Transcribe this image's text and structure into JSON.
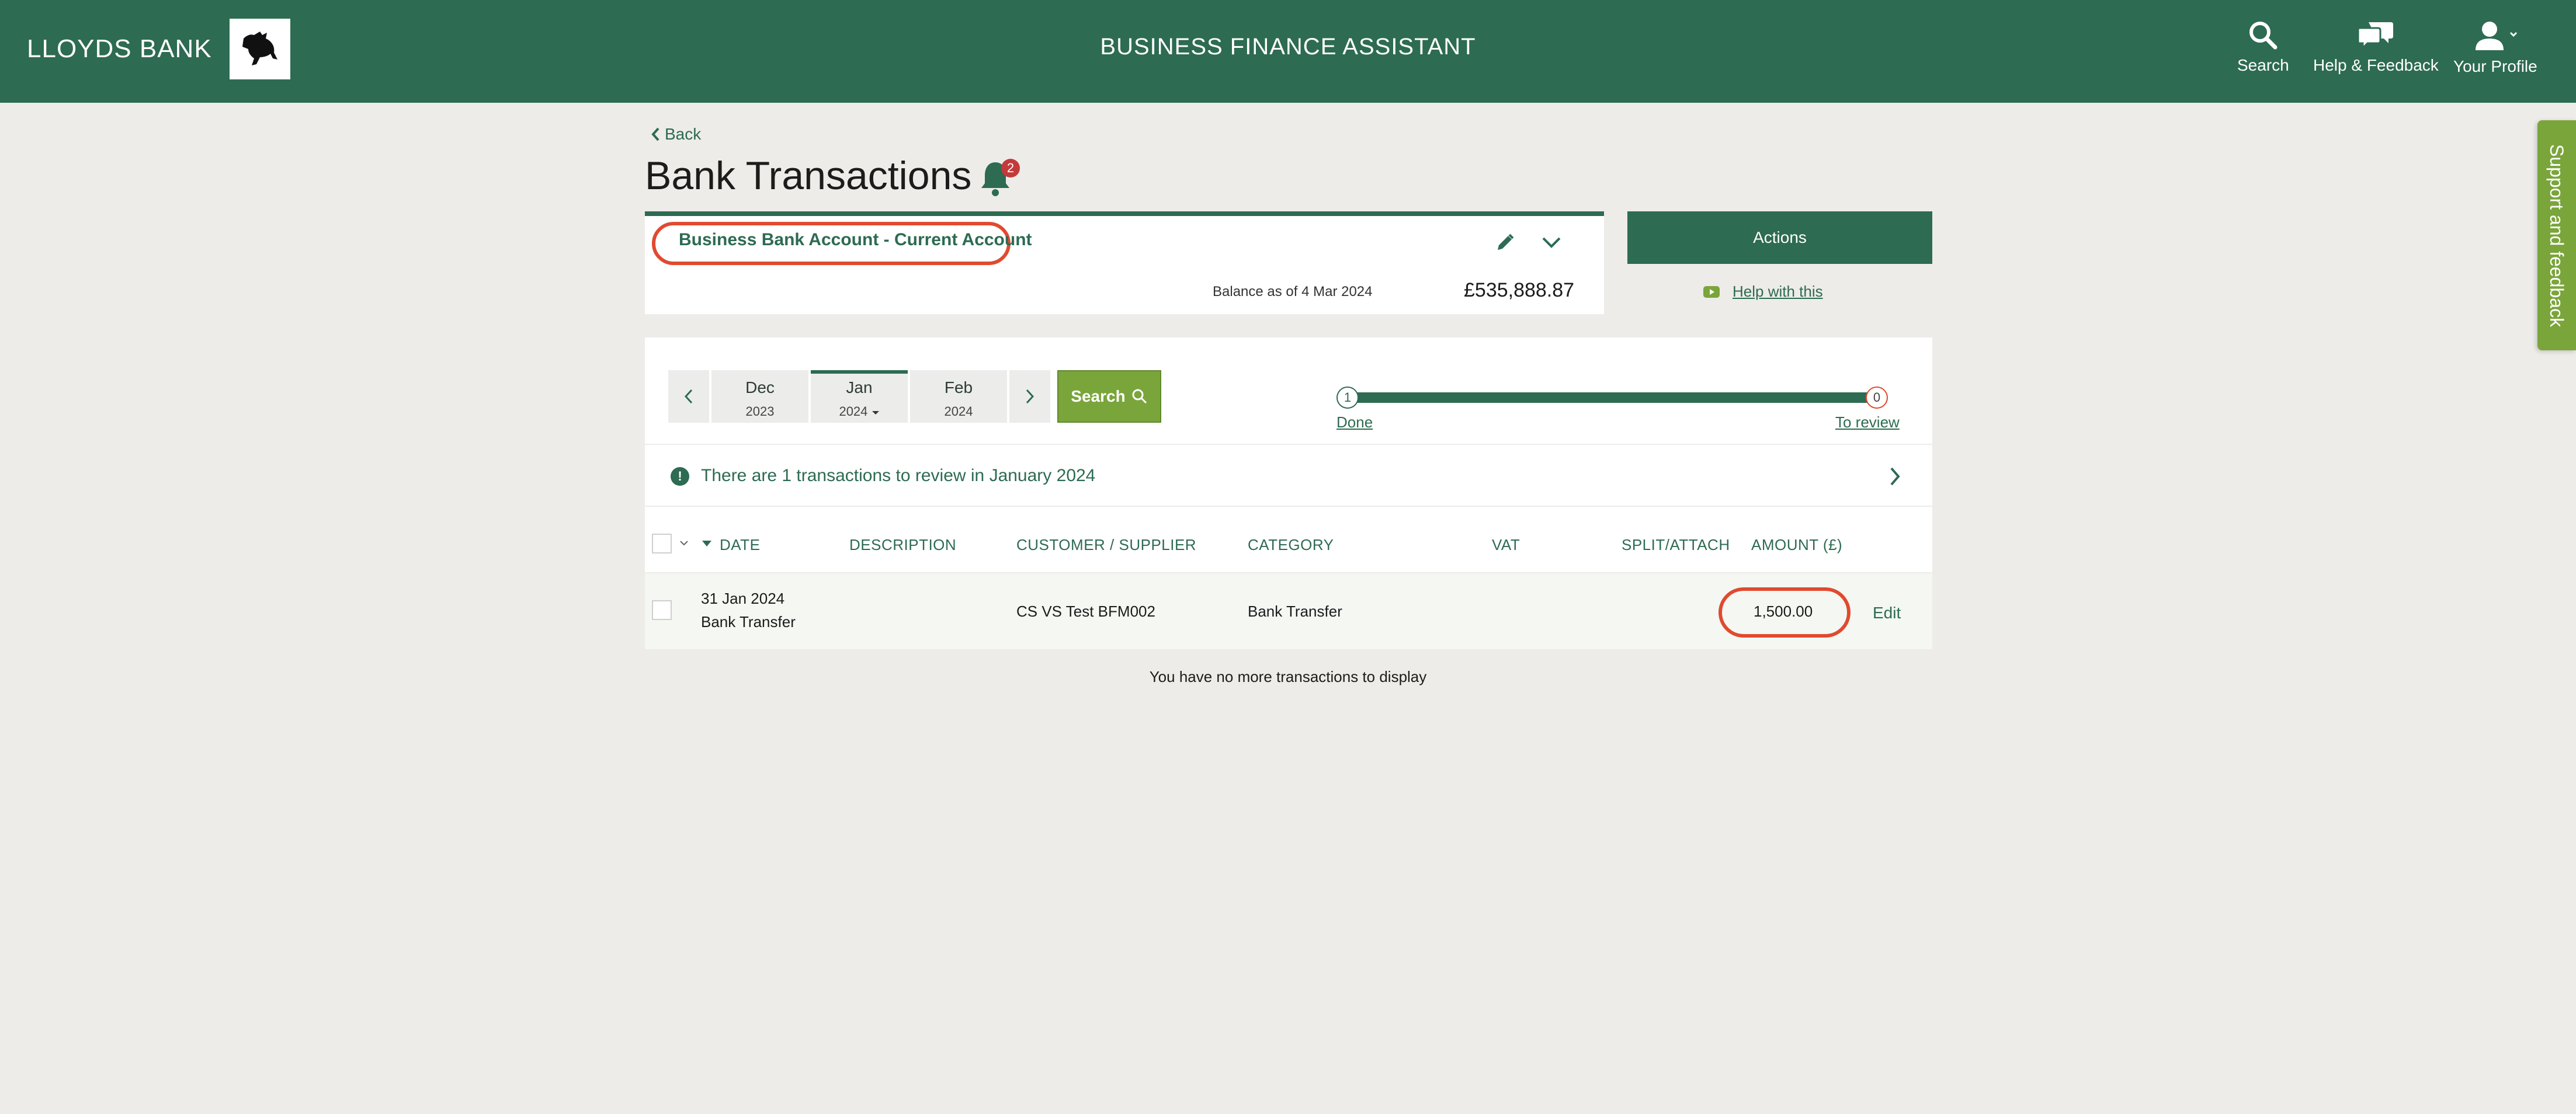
{
  "header": {
    "brand": "LLOYDS BANK",
    "title": "BUSINESS FINANCE ASSISTANT",
    "nav": {
      "search": "Search",
      "help": "Help & Feedback",
      "profile": "Your Profile"
    }
  },
  "feedback_tab": "Support and feedback",
  "page": {
    "back": "Back",
    "title": "Bank Transactions",
    "notifications_count": "2"
  },
  "account": {
    "name": "Business Bank Account - Current Account",
    "balance_label": "Balance as of 4 Mar 2024",
    "balance_value": "£535,888.87"
  },
  "actions": {
    "button": "Actions",
    "help_link": "Help with this"
  },
  "months": [
    {
      "month": "Dec",
      "year": "2023"
    },
    {
      "month": "Jan",
      "year": "2024"
    },
    {
      "month": "Feb",
      "year": "2024"
    }
  ],
  "search_button": "Search",
  "progress": {
    "done_count": "1",
    "done_label": "Done",
    "review_count": "0",
    "review_label": "To review"
  },
  "review_banner": "There are 1 transactions to review in January 2024",
  "table": {
    "columns": {
      "date": "DATE",
      "description": "DESCRIPTION",
      "customer": "CUSTOMER / SUPPLIER",
      "category": "CATEGORY",
      "vat": "VAT",
      "split": "SPLIT/ATTACH",
      "amount": "AMOUNT (£)"
    },
    "rows": [
      {
        "date": "31 Jan 2024",
        "type": "Bank Transfer",
        "customer": "CS VS Test BFM002",
        "category": "Bank Transfer",
        "amount": "1,500.00",
        "edit": "Edit"
      }
    ],
    "no_more": "You have no more transactions to display"
  },
  "colors": {
    "brand_green": "#2d6b52",
    "accent_green": "#7aa53b",
    "highlight_red": "#e04a2f",
    "badge_red": "#c23a3a"
  }
}
